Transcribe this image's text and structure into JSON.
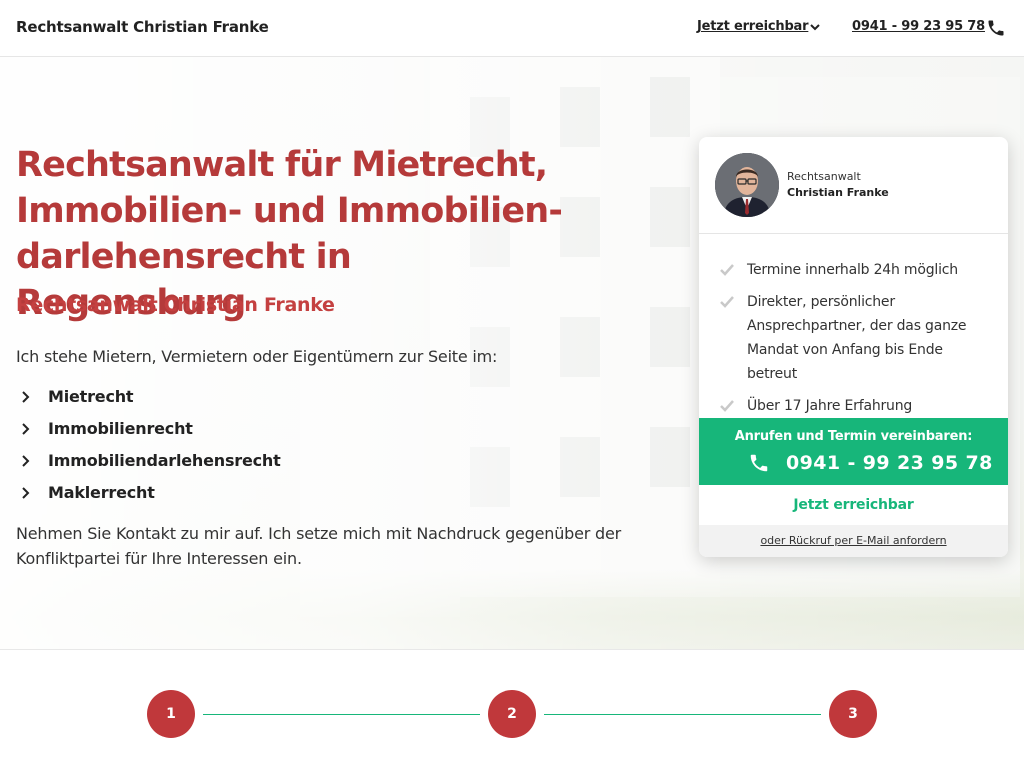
{
  "header": {
    "brand": "Rechtsanwalt Christian Franke",
    "reach_label": "Jetzt erreichbar",
    "chevron_icon": "chevron-down-icon",
    "phone": "0941 - 99 23 95 78",
    "phone_icon": "phone-icon"
  },
  "hero": {
    "title_lines": [
      "Rechtsanwalt für Mietrecht,",
      "Immobilien- und Immobilien-",
      "darlehensrecht in Regensburg"
    ],
    "subtitle": "Rechtsanwalt Christian Franke",
    "intro": "Ich stehe Mietern, Vermietern oder Eigentümern zur Seite im:",
    "practice_areas": [
      "Mietrecht",
      "Immobilienrecht",
      "Immobiliendarlehensrecht",
      "Maklerrecht"
    ],
    "outro": "Nehmen Sie Kontakt zu mir auf. Ich setze mich mit Nachdruck gegenüber der Konfliktpartei für Ihre Interessen ein."
  },
  "contact_card": {
    "role": "Rechtsanwalt",
    "name": "Christian Franke",
    "benefits": [
      "Termine innerhalb 24h möglich",
      "Direkter, persönlicher Ansprechpartner, der das ganze Mandat von Anfang bis Ende betreut",
      "Über 17 Jahre Erfahrung"
    ],
    "cta_label": "Anrufen und Termin vereinbaren:",
    "cta_phone": "0941 - 99 23 95 78",
    "reach_label": "Jetzt erreichbar",
    "email_link": "oder Rückruf per E-Mail anfordern"
  },
  "steps": [
    "1",
    "2",
    "3"
  ],
  "colors": {
    "accent_red": "#b53a3a",
    "step_red": "#c0383b",
    "accent_green": "#17b67a",
    "text_dark": "#222222"
  }
}
